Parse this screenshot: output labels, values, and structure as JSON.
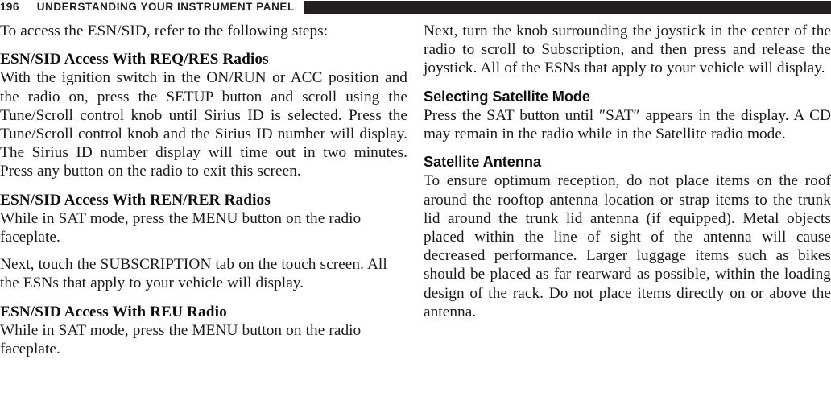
{
  "header": {
    "page_number": "196",
    "title": "UNDERSTANDING YOUR INSTRUMENT PANEL",
    "rule_color": "#231f20"
  },
  "left_column": {
    "intro_paragraph": "To access the ESN/SID, refer to the following steps:",
    "section_1": {
      "heading": "ESN/SID Access With REQ/RES Radios",
      "body": "With the ignition switch in the ON/RUN or ACC position and the radio on, press the SETUP button and scroll using the Tune/Scroll control knob until Sirius ID is selected. Press the Tune/Scroll control knob and the Sirius ID number will display. The Sirius ID number display will time out in two minutes. Press any button on the radio to exit this screen."
    },
    "section_2": {
      "heading": "ESN/SID Access With REN/RER Radios",
      "body_1": "While in SAT mode, press the MENU button on the radio faceplate.",
      "body_2": "Next, touch the SUBSCRIPTION tab on the touch screen. All the ESNs that apply to your vehicle will display."
    },
    "section_3": {
      "heading": "ESN/SID Access With REU Radio",
      "body": "While in SAT mode, press the MENU button on the radio faceplate."
    }
  },
  "right_column": {
    "continuation_paragraph": "Next, turn the knob surrounding the joystick in the center of the radio to scroll to Subscription, and then press and release the joystick. All of the ESNs that apply to your vehicle will display.",
    "section_1": {
      "heading": "Selecting Satellite Mode",
      "body": "Press the SAT button until ″SAT″ appears in the display. A CD may remain in the radio while in the Satellite radio mode."
    },
    "section_2": {
      "heading": "Satellite Antenna",
      "body": "To ensure optimum reception, do not place items on the roof around the rooftop antenna location or strap items to the trunk lid around the trunk lid antenna (if equipped). Metal objects placed within the line of sight of the antenna will cause decreased performance. Larger luggage items such as bikes should be placed as far rearward as possible, within the loading design of the rack. Do not place items directly on or above the antenna."
    }
  }
}
